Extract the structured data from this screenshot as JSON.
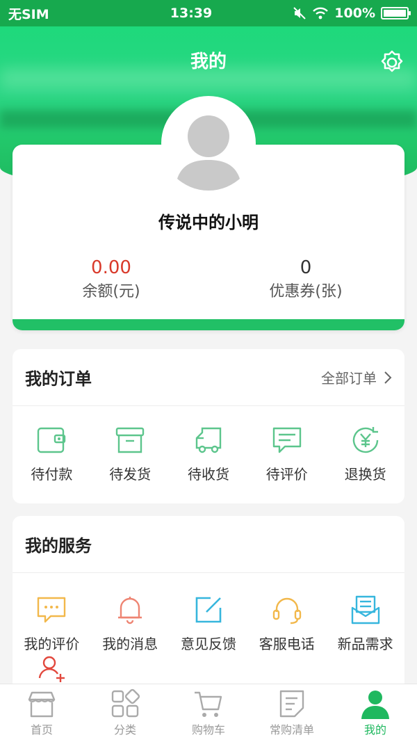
{
  "status_bar": {
    "carrier": "无SIM",
    "time": "13:39",
    "battery": "100%",
    "battery_level": 1.0
  },
  "header": {
    "title": "我的",
    "settings_icon": "gear-icon"
  },
  "profile": {
    "name": "传说中的小明",
    "balance_value": "0.00",
    "balance_label": "余额(元)",
    "coupon_value": "0",
    "coupon_label": "优惠券(张)"
  },
  "orders": {
    "title": "我的订单",
    "more_label": "全部订单",
    "items": [
      {
        "label": "待付款",
        "icon": "wallet-icon"
      },
      {
        "label": "待发货",
        "icon": "box-icon"
      },
      {
        "label": "待收货",
        "icon": "truck-icon"
      },
      {
        "label": "待评价",
        "icon": "comment-icon"
      },
      {
        "label": "退换货",
        "icon": "refund-icon"
      }
    ]
  },
  "services": {
    "title": "我的服务",
    "items": [
      {
        "label": "我的评价",
        "icon": "chat-bubble-icon"
      },
      {
        "label": "我的消息",
        "icon": "bell-icon"
      },
      {
        "label": "意见反馈",
        "icon": "edit-icon"
      },
      {
        "label": "客服电话",
        "icon": "headset-icon"
      },
      {
        "label": "新品需求",
        "icon": "mail-icon"
      }
    ],
    "extra_icon": "add-user-icon"
  },
  "tabs": [
    {
      "label": "首页",
      "icon": "store-icon",
      "active": false
    },
    {
      "label": "分类",
      "icon": "grid-icon",
      "active": false
    },
    {
      "label": "购物车",
      "icon": "cart-icon",
      "active": false
    },
    {
      "label": "常购清单",
      "icon": "list-icon",
      "active": false
    },
    {
      "label": "我的",
      "icon": "user-icon",
      "active": true
    }
  ],
  "colors": {
    "brand_green": "#1fb85f",
    "balance_red": "#d93a2b",
    "order_icon": "#5cc58c"
  }
}
